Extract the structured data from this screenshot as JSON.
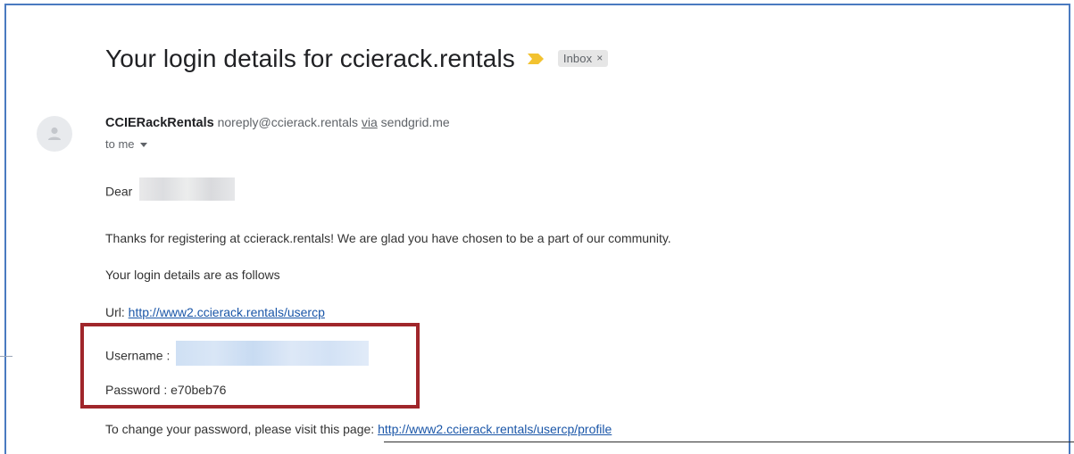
{
  "email": {
    "subject": "Your login details for ccierack.rentals",
    "inbox_chip": {
      "label": "Inbox",
      "close": "×"
    },
    "sender": {
      "name": "CCIERackRentals",
      "address": "noreply@ccierack.rentals",
      "via_label": "via",
      "via_domain": "sendgrid.me"
    },
    "recipient_label": "to me",
    "body": {
      "greeting": "Dear",
      "thanks": "Thanks for registering at ccierack.rentals! We are glad you have chosen to be a part of our community.",
      "intro": "Your login details are as follows",
      "url_label": "Url:",
      "url": "http://www2.ccierack.rentals/usercp",
      "username_label": "Username :",
      "password_label": "Password : e70beb76",
      "change_text": "To change your password, please visit this page:",
      "profile_url": "http://www2.ccierack.rentals/usercp/profile"
    }
  },
  "colors": {
    "frame_border": "#4a7ac0",
    "highlight_border": "#a0262b",
    "link": "#1a56a8",
    "important_marker": "#f2c230"
  },
  "icons": {
    "avatar": "person-icon",
    "label_marker": "important-marker-icon",
    "dropdown": "caret-down-icon"
  }
}
